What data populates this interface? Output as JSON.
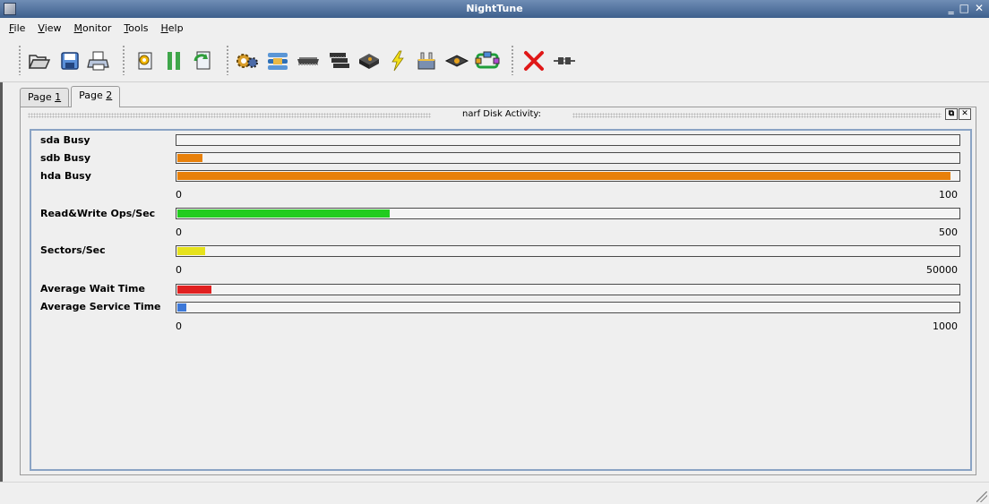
{
  "window": {
    "title": "NightTune"
  },
  "menu": [
    {
      "pre": "",
      "u": "F",
      "post": "ile"
    },
    {
      "pre": "",
      "u": "V",
      "post": "iew"
    },
    {
      "pre": "",
      "u": "M",
      "post": "onitor"
    },
    {
      "pre": "",
      "u": "T",
      "post": "ools"
    },
    {
      "pre": "",
      "u": "H",
      "post": "elp"
    }
  ],
  "toolbar_icons": [
    "open-folder-icon",
    "save-icon",
    "print-icon",
    "settings-sheet-icon",
    "pause-icon",
    "reload-sheet-icon",
    "cpu-gears-icon",
    "process-list-icon",
    "memory-chip-icon",
    "network-stack-icon",
    "disk-icon",
    "interrupt-bolt-icon",
    "network-device-icon",
    "device-disk-icon",
    "swap-icon",
    "close-red-icon",
    "connect-icon"
  ],
  "tabs": [
    {
      "pre": "Page ",
      "u": "1"
    },
    {
      "pre": "Page ",
      "u": "2"
    }
  ],
  "active_tab": 1,
  "panel": {
    "title": "narf Disk Activity:"
  },
  "metrics": {
    "sda": {
      "label": "sda Busy",
      "value": 0,
      "max": 100,
      "color": "#e8800a"
    },
    "sdb": {
      "label": "sdb Busy",
      "value": 3.2,
      "max": 100,
      "color": "#e8800a"
    },
    "hda": {
      "label": "hda Busy",
      "value": 99,
      "max": 100,
      "color": "#e8800a"
    },
    "ops": {
      "label": "Read&Write Ops/Sec",
      "value": 136,
      "max": 500,
      "color": "#22cc1f"
    },
    "sectors": {
      "label": "Sectors/Sec",
      "value": 1800,
      "max": 50000,
      "color": "#e6e21c"
    },
    "wait": {
      "label": "Average Wait Time",
      "value": 44,
      "max": 1000,
      "color": "#e02020"
    },
    "service": {
      "label": "Average Service Time",
      "value": 12,
      "max": 1000,
      "color": "#3d78d8"
    }
  },
  "scales": {
    "busy": {
      "min": "0",
      "max": "100"
    },
    "ops": {
      "min": "0",
      "max": "500"
    },
    "sectors": {
      "min": "0",
      "max": "50000"
    },
    "time": {
      "min": "0",
      "max": "1000"
    }
  }
}
